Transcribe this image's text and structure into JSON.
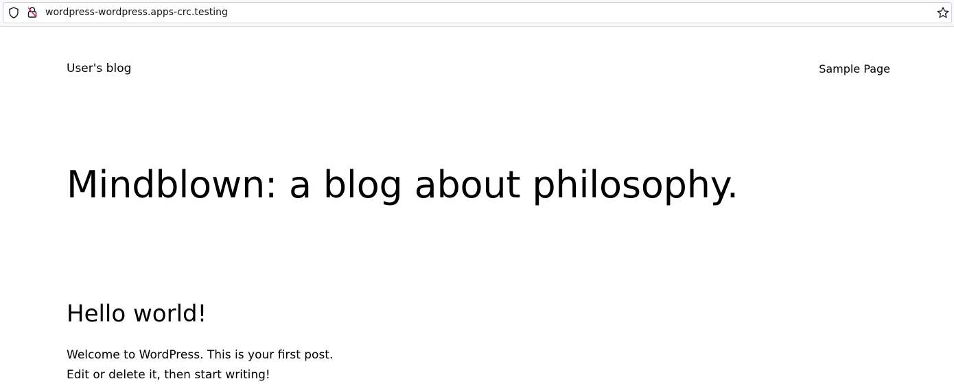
{
  "browser": {
    "url": "wordpress-wordpress.apps-crc.testing",
    "icons": {
      "shield": "shield-icon",
      "lock": "lock-warning-icon",
      "star": "bookmark-star-icon"
    }
  },
  "site": {
    "title": "User's blog",
    "nav": [
      "Sample Page"
    ]
  },
  "hero": {
    "heading": "Mindblown: a blog about philosophy."
  },
  "post": {
    "title": "Hello world!",
    "lines": [
      "Welcome to WordPress. This is your first post.",
      "Edit or delete it, then start writing!"
    ]
  },
  "colors": {
    "lock_accent": "#e22850"
  }
}
